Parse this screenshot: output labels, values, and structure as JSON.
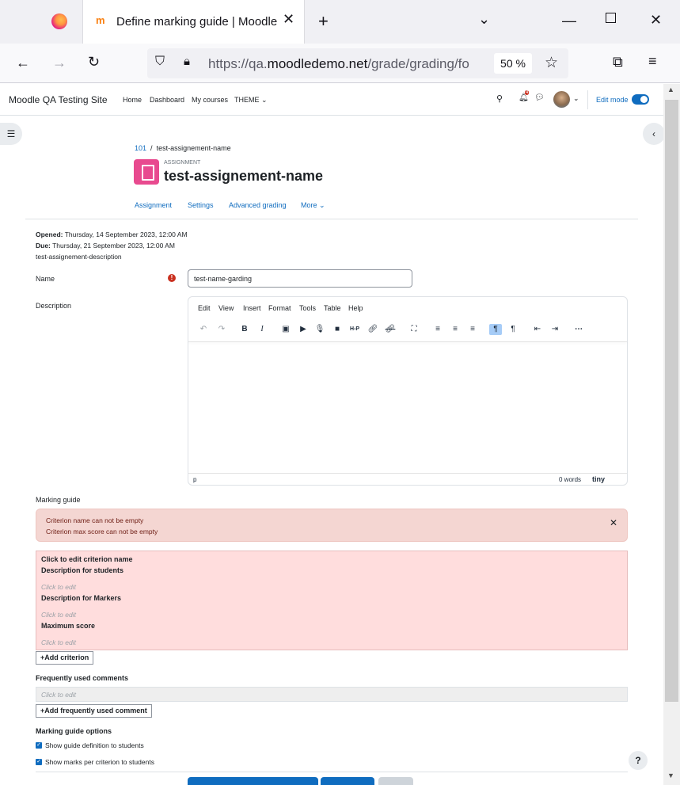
{
  "browser": {
    "tab_title": "Define marking guide | Moodle",
    "url_prefix": "https://qa.",
    "url_domain": "moodledemo.net",
    "url_path": "/grade/grading/fo",
    "zoom": "50 %"
  },
  "navbar": {
    "site_name": "Moodle QA Testing Site",
    "links": [
      "Home",
      "Dashboard",
      "My courses",
      "THEME"
    ],
    "notification_count": "4",
    "edit_mode_label": "Edit mode"
  },
  "breadcrumb": {
    "course": "101",
    "separator": "/",
    "current": "test-assignement-name"
  },
  "header": {
    "kicker": "ASSIGNMENT",
    "title": "test-assignement-name"
  },
  "tabs": [
    "Assignment",
    "Settings",
    "Advanced grading",
    "More"
  ],
  "meta": {
    "opened_label": "Opened:",
    "opened_value": "Thursday, 14 September 2023, 12:00 AM",
    "due_label": "Due:",
    "due_value": "Thursday, 21 September 2023, 12:00 AM",
    "description": "test-assignement-description"
  },
  "form": {
    "name_label": "Name",
    "name_value": "test-name-garding",
    "description_label": "Description",
    "marking_guide_label": "Marking guide"
  },
  "editor": {
    "menus": [
      "Edit",
      "View",
      "Insert",
      "Format",
      "Tools",
      "Table",
      "Help"
    ],
    "status_path": "p",
    "word_count": "0 words",
    "brand": "tiny"
  },
  "alert": {
    "line1": "Criterion name can not be empty",
    "line2": "Criterion max score can not be empty"
  },
  "criterion": {
    "name": "Click to edit criterion name",
    "desc_students": "Description for students",
    "desc_markers": "Description for Markers",
    "max_score": "Maximum score",
    "placeholder": "Click to edit",
    "add_button": "Add criterion"
  },
  "comments": {
    "heading": "Frequently used comments",
    "placeholder": "Click to edit",
    "add_button": "Add frequently used comment"
  },
  "options": {
    "heading": "Marking guide options",
    "opt1": "Show guide definition to students",
    "opt2": "Show marks per criterion to students"
  },
  "help_label": "?",
  "colors": {
    "primary": "#0f6cbf",
    "danger": "#ca3120",
    "alert_bg": "#f4d6d2",
    "criterion_bg": "#ffdddd",
    "assign_icon": "#e84a8f"
  }
}
